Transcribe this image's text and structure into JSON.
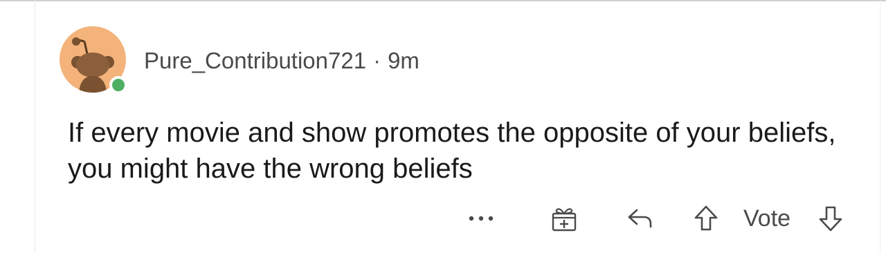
{
  "comment": {
    "username": "Pure_Contribution721",
    "separator": "·",
    "age": "9m",
    "text": "If every movie and show promotes the opposite of your beliefs, you might have the wrong beliefs"
  },
  "actions": {
    "more_icon": "more-horizontal-icon",
    "award_icon": "gift-award-icon",
    "reply_icon": "reply-arrow-icon",
    "upvote_icon": "upvote-arrow-icon",
    "vote_label": "Vote",
    "downvote_icon": "downvote-arrow-icon"
  },
  "colors": {
    "avatar_bg": "#f3b37a",
    "online": "#4caf63",
    "text": "#1a1a1a",
    "meta": "#4a4a4a"
  }
}
